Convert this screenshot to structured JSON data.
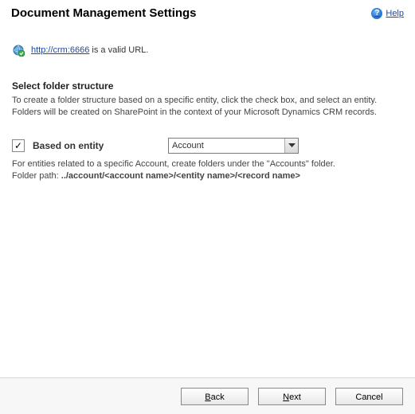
{
  "title": "Document Management Settings",
  "help_label": "Help",
  "url_section": {
    "url": "http://crm:6666",
    "status_suffix": " is a valid URL."
  },
  "folder_section": {
    "heading": "Select folder structure",
    "description": "To create a folder structure based on a specific entity, click the check box, and select an entity. Folders will be created on SharePoint in the context of your Microsoft Dynamics CRM records.",
    "checkbox": {
      "checked": true,
      "label": "Based on entity"
    },
    "entity_select": {
      "value": "Account"
    },
    "note_line1": "For entities related to a specific Account, create folders under the \"Accounts\" folder.",
    "note_line2_prefix": "Folder path: ",
    "note_line2_path": "../account/<account name>/<entity name>/<record name>"
  },
  "buttons": {
    "back": "Back",
    "next": "Next",
    "cancel": "Cancel"
  }
}
